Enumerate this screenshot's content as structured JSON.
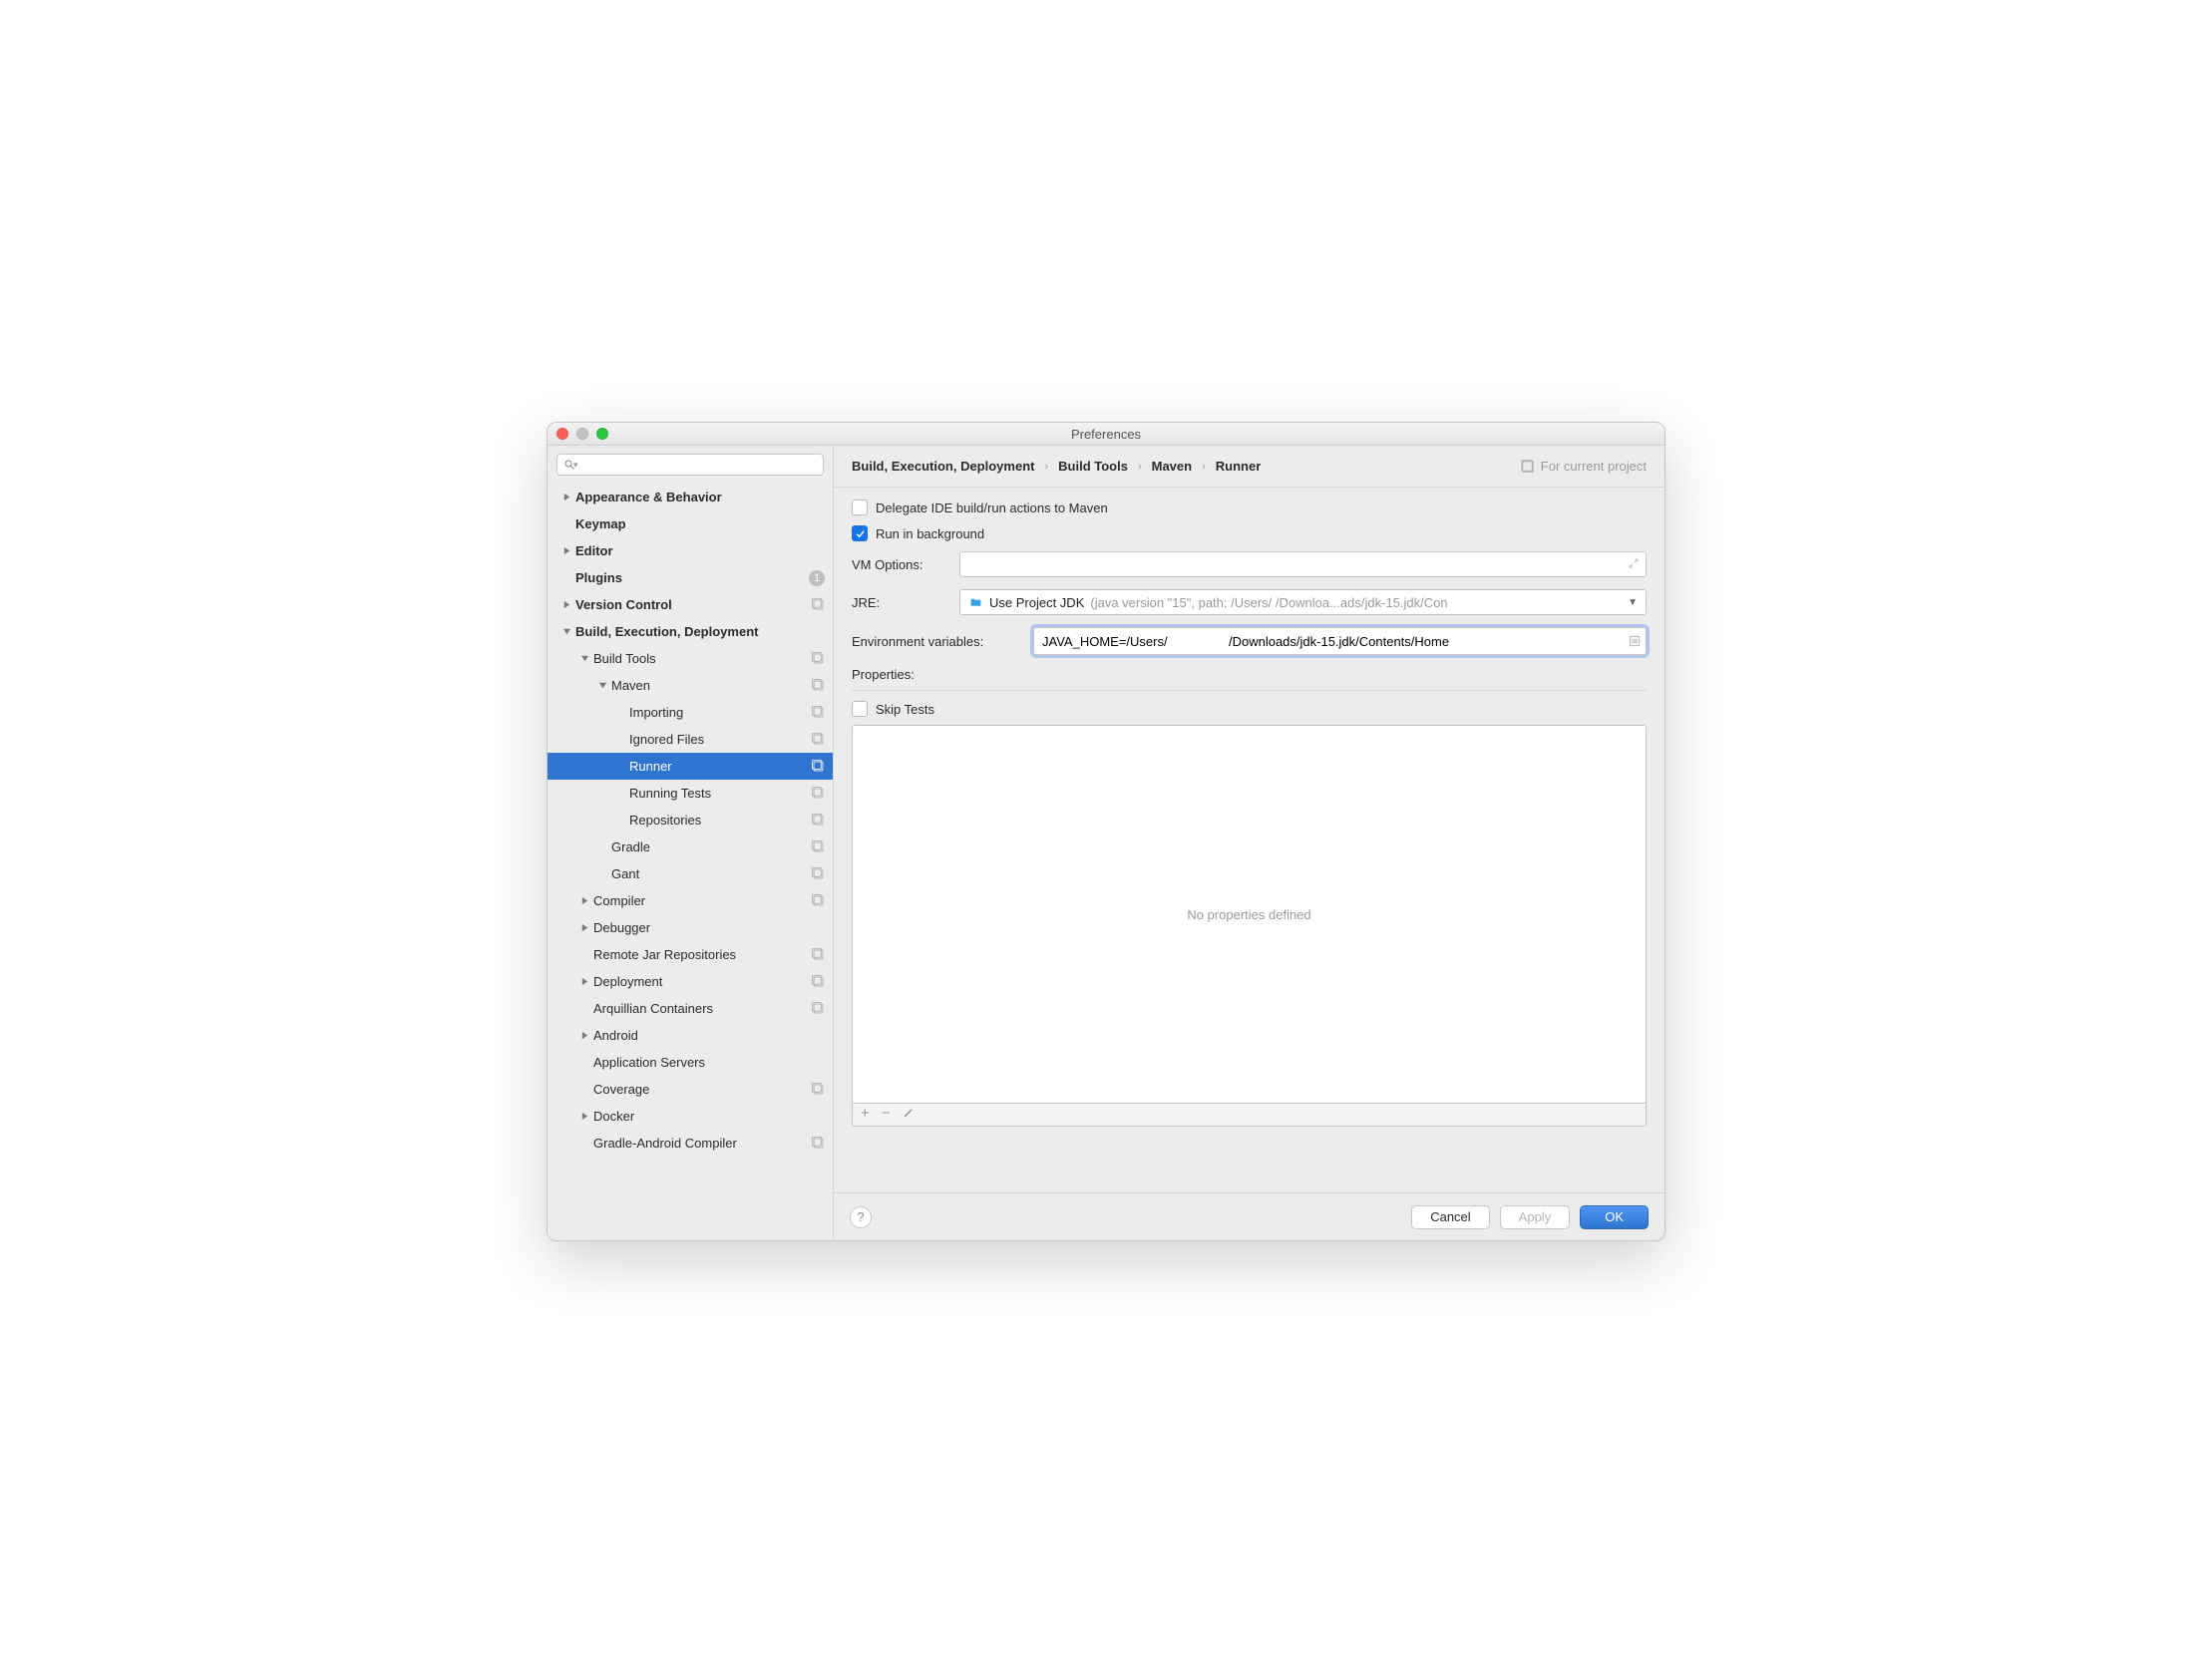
{
  "window": {
    "title": "Preferences"
  },
  "search": {
    "placeholder": ""
  },
  "sidebar": [
    {
      "label": "Appearance & Behavior",
      "indent": 0,
      "arrow": "right",
      "bold": true
    },
    {
      "label": "Keymap",
      "indent": 0,
      "arrow": "",
      "bold": true
    },
    {
      "label": "Editor",
      "indent": 0,
      "arrow": "right",
      "bold": true
    },
    {
      "label": "Plugins",
      "indent": 0,
      "arrow": "",
      "bold": true,
      "count": "1"
    },
    {
      "label": "Version Control",
      "indent": 0,
      "arrow": "right",
      "bold": true,
      "proj": true
    },
    {
      "label": "Build, Execution, Deployment",
      "indent": 0,
      "arrow": "down",
      "bold": true
    },
    {
      "label": "Build Tools",
      "indent": 1,
      "arrow": "down",
      "proj": true
    },
    {
      "label": "Maven",
      "indent": 2,
      "arrow": "down",
      "proj": true
    },
    {
      "label": "Importing",
      "indent": 3,
      "arrow": "",
      "proj": true
    },
    {
      "label": "Ignored Files",
      "indent": 3,
      "arrow": "",
      "proj": true
    },
    {
      "label": "Runner",
      "indent": 3,
      "arrow": "",
      "proj": true,
      "selected": true
    },
    {
      "label": "Running Tests",
      "indent": 3,
      "arrow": "",
      "proj": true
    },
    {
      "label": "Repositories",
      "indent": 3,
      "arrow": "",
      "proj": true
    },
    {
      "label": "Gradle",
      "indent": 2,
      "arrow": "",
      "proj": true
    },
    {
      "label": "Gant",
      "indent": 2,
      "arrow": "",
      "proj": true
    },
    {
      "label": "Compiler",
      "indent": 1,
      "arrow": "right",
      "proj": true
    },
    {
      "label": "Debugger",
      "indent": 1,
      "arrow": "right"
    },
    {
      "label": "Remote Jar Repositories",
      "indent": 1,
      "arrow": "",
      "proj": true
    },
    {
      "label": "Deployment",
      "indent": 1,
      "arrow": "right",
      "proj": true
    },
    {
      "label": "Arquillian Containers",
      "indent": 1,
      "arrow": "",
      "proj": true
    },
    {
      "label": "Android",
      "indent": 1,
      "arrow": "right"
    },
    {
      "label": "Application Servers",
      "indent": 1,
      "arrow": ""
    },
    {
      "label": "Coverage",
      "indent": 1,
      "arrow": "",
      "proj": true
    },
    {
      "label": "Docker",
      "indent": 1,
      "arrow": "right"
    },
    {
      "label": "Gradle-Android Compiler",
      "indent": 1,
      "arrow": "",
      "proj": true
    }
  ],
  "breadcrumb": [
    "Build, Execution, Deployment",
    "Build Tools",
    "Maven",
    "Runner"
  ],
  "for_project": "For current project",
  "checkboxes": {
    "delegate": {
      "label": "Delegate IDE build/run actions to Maven",
      "checked": false
    },
    "background": {
      "label": "Run in background",
      "checked": true
    },
    "skip_tests": {
      "label": "Skip Tests",
      "checked": false
    }
  },
  "labels": {
    "vm_options": "VM Options:",
    "jre": "JRE:",
    "env_vars": "Environment variables:",
    "properties": "Properties:"
  },
  "jre": {
    "prefix": "Use Project JDK",
    "detail": "(java version \"15\", path: /Users/               /Downloa...ads/jdk-15.jdk/Con"
  },
  "env_value": "JAVA_HOME=/Users/                 /Downloads/jdk-15.jdk/Contents/Home",
  "properties_empty": "No properties defined",
  "vm_options_value": "",
  "buttons": {
    "cancel": "Cancel",
    "apply": "Apply",
    "ok": "OK"
  }
}
